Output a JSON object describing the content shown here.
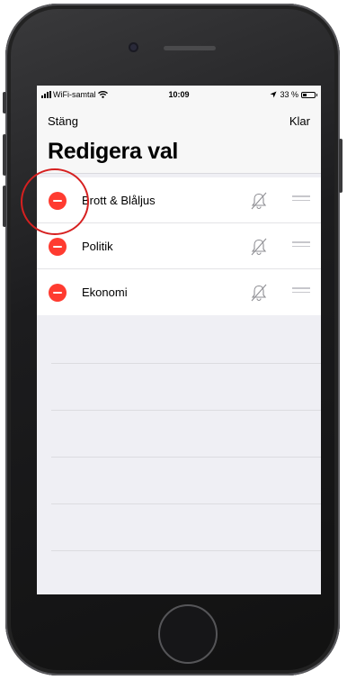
{
  "status_bar": {
    "carrier": "WiFi-samtal",
    "time": "10:09",
    "battery": "33 %",
    "battery_level": 0.33
  },
  "header": {
    "close_label": "Stäng",
    "done_label": "Klar",
    "title": "Redigera val"
  },
  "list": {
    "items": [
      {
        "label": "Brott & Blåljus",
        "icon": "bell-slash-icon"
      },
      {
        "label": "Politik",
        "icon": "bell-slash-icon"
      },
      {
        "label": "Ekonomi",
        "icon": "bell-slash-icon"
      }
    ]
  },
  "colors": {
    "delete": "#ff3b30",
    "annotation": "#d62020"
  }
}
